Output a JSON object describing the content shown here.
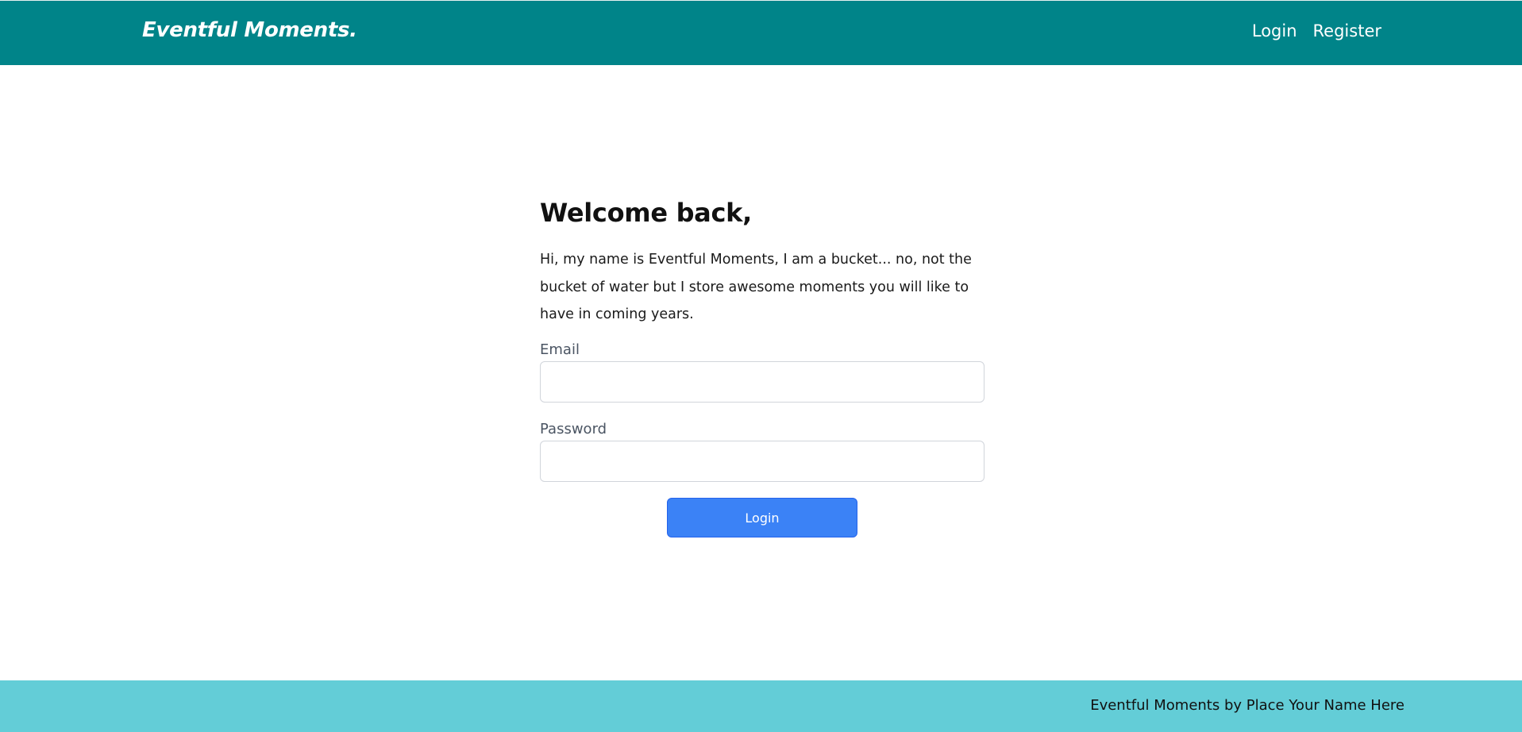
{
  "navbar": {
    "brand": "Eventful Moments.",
    "links": [
      "Login",
      "Register"
    ]
  },
  "main": {
    "heading": "Welcome back,",
    "intro": "Hi, my name is Eventful Moments, I am a bucket... no, not the bucket of water but I store awesome moments you will like to have in coming years.",
    "email_label": "Email",
    "email_value": "",
    "password_label": "Password",
    "password_value": "",
    "login_button": "Login"
  },
  "footer": {
    "text": "Eventful Moments by Place Your Name Here"
  },
  "colors": {
    "navbar_bg": "#008489",
    "footer_bg": "#63cdd7",
    "button_bg": "#3b82f6"
  }
}
